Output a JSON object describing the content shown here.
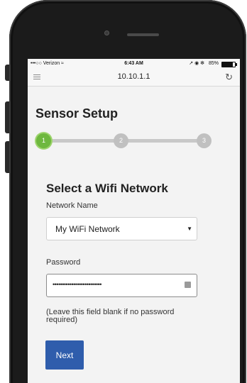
{
  "status_bar": {
    "carrier": "•••○○ Verizon ≈",
    "time": "6:43 AM",
    "icons": "↗ ◉ ✻",
    "battery_text": "85%",
    "battery_level": 0.85
  },
  "address_bar": {
    "url": "10.10.1.1"
  },
  "page": {
    "title": "Sensor Setup",
    "steps": [
      "1",
      "2",
      "3"
    ],
    "active_step": 1
  },
  "wifi_form": {
    "heading": "Select a Wifi Network",
    "network_label": "Network Name",
    "network_value": "My WiFi Network",
    "password_label": "Password",
    "password_value": "••••••••••••••••••••••••••",
    "help_text": "(Leave this field blank if no password required)",
    "next_label": "Next"
  },
  "colors": {
    "active_step": "#6eb83e",
    "inactive_step": "#c0c0c0",
    "next_button": "#2f5dac"
  }
}
